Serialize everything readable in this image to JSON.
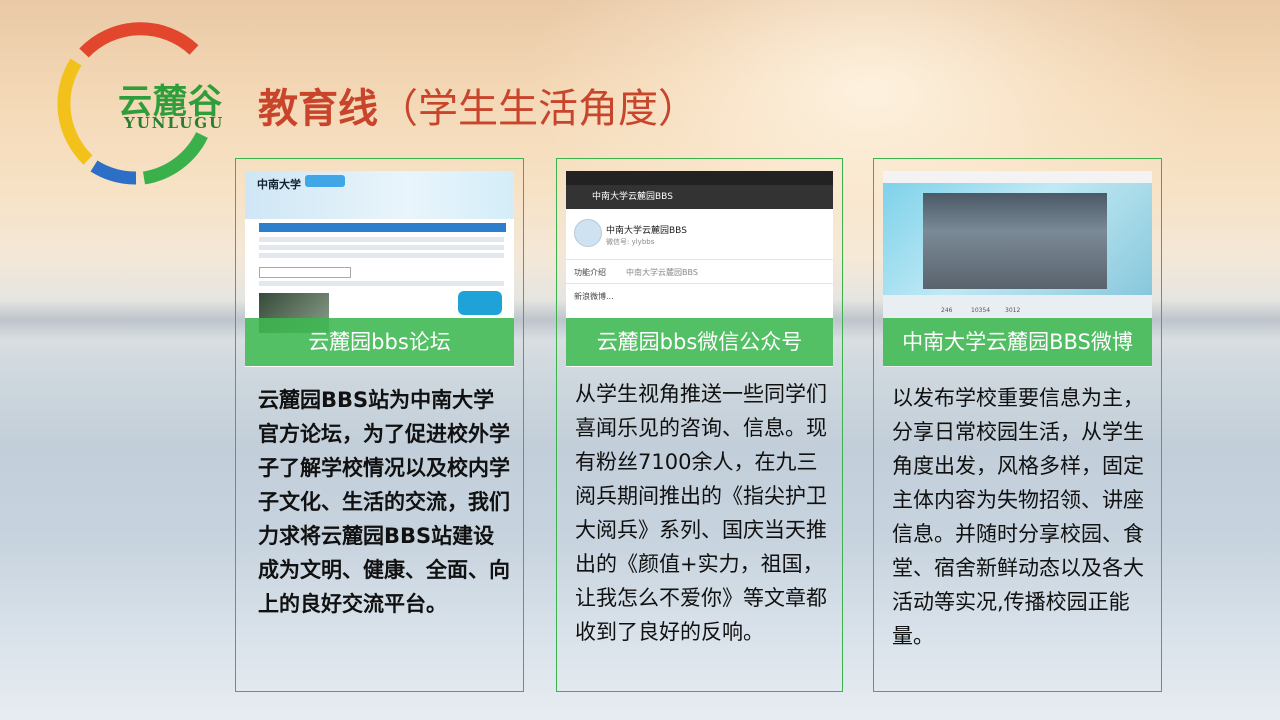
{
  "logo": {
    "cn": "云麓谷",
    "en": "YUNLUGU"
  },
  "title": {
    "main": "教育线",
    "sub": "（学生生活角度）"
  },
  "cards": [
    {
      "label": "云麓园bbs论坛",
      "desc": "云麓园BBS站为中南大学官方论坛，为了促进校外学子了解学校情况以及校内学子文化、生活的交流，我们力求将云麓园BBS站建设成为文明、健康、全面、向上的良好交流平台。",
      "shot": {
        "site_name": "中南大学"
      }
    },
    {
      "label": "云麓园bbs微信公众号",
      "desc": "从学生视角推送一些同学们喜闻乐见的咨询、信息。现有粉丝7100余人，在九三阅兵期间推出的《指尖护卫大阅兵》系列、国庆当天推出的《颜值+实力，祖国，让我怎么不爱你》等文章都收到了良好的反响。",
      "shot": {
        "header": "中南大学云麓园BBS",
        "account_name": "中南大学云麓园BBS",
        "account_id": "微信号: ylybbs",
        "intro_label": "功能介绍",
        "intro_value": "中南大学云麓园BBS",
        "weibo_label": "新浪微博..."
      }
    },
    {
      "label": "中南大学云麓园BBS微博",
      "desc": "以发布学校重要信息为主，分享日常校园生活，从学生角度出发，风格多样，固定主体内容为失物招领、讲座信息。并随时分享校园、食堂、宿舍新鲜动态以及各大活动等实况,传播校园正能量。",
      "shot": {
        "stats": [
          "246",
          "10354",
          "3012"
        ]
      }
    }
  ]
}
